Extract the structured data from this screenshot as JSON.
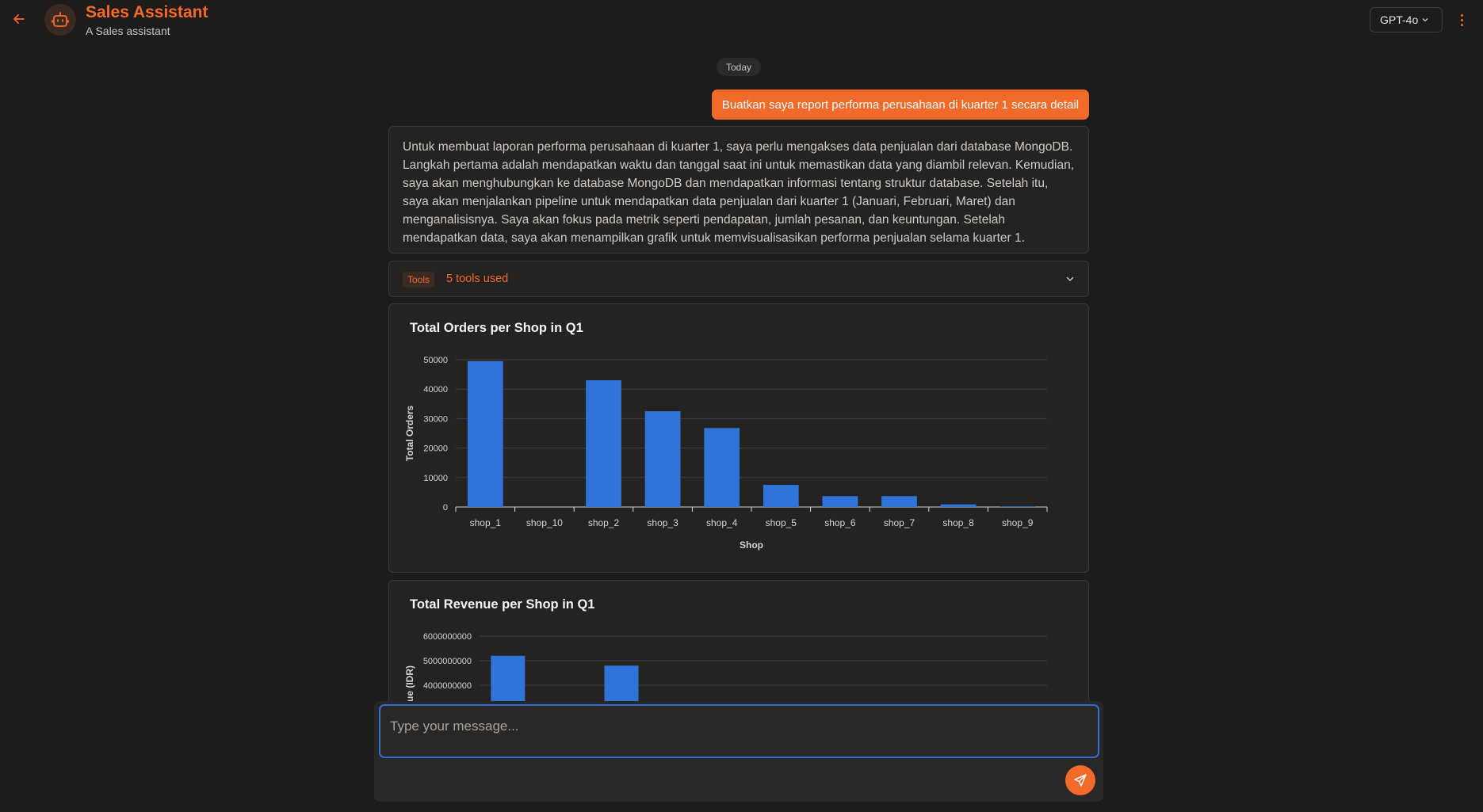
{
  "header": {
    "title": "Sales Assistant",
    "subtitle": "A Sales assistant",
    "model": "GPT-4o"
  },
  "chat": {
    "date_label": "Today",
    "user_message": "Buatkan saya report performa perusahaan di kuarter 1 secara detail",
    "assistant_message": "Untuk membuat laporan performa perusahaan di kuarter 1, saya perlu mengakses data penjualan dari database MongoDB. Langkah pertama adalah mendapatkan waktu dan tanggal saat ini untuk memastikan data yang diambil relevan. Kemudian, saya akan menghubungkan ke database MongoDB dan mendapatkan informasi tentang struktur database. Setelah itu, saya akan menjalankan pipeline untuk mendapatkan data penjualan dari kuarter 1 (Januari, Februari, Maret) dan menganalisisnya. Saya akan fokus pada metrik seperti pendapatan, jumlah pesanan, dan keuntungan. Setelah mendapatkan data, saya akan menampilkan grafik untuk memvisualisasikan performa penjualan selama kuarter 1.",
    "tools_badge": "Tools",
    "tools_count": "5 tools used"
  },
  "composer": {
    "placeholder": "Type your message..."
  },
  "colors": {
    "accent": "#f26a2a",
    "bar": "#2f74d8",
    "background": "#1e1c1b"
  },
  "chart_data": [
    {
      "type": "bar",
      "title": "Total Orders per Shop in Q1",
      "xlabel": "Shop",
      "ylabel": "Total Orders",
      "categories": [
        "shop_1",
        "shop_10",
        "shop_2",
        "shop_3",
        "shop_4",
        "shop_5",
        "shop_6",
        "shop_7",
        "shop_8",
        "shop_9"
      ],
      "values": [
        49500,
        0,
        43000,
        32500,
        26800,
        7500,
        3700,
        3700,
        900,
        200
      ],
      "yticks": [
        "0",
        "10000",
        "20000",
        "30000",
        "40000",
        "50000"
      ],
      "ylim": [
        0,
        50000
      ],
      "grid": true
    },
    {
      "type": "bar",
      "title": "Total Revenue per Shop in Q1",
      "ylabel": "ue (IDR)",
      "visible_yticks": [
        "6000000000",
        "5000000000",
        "4000000000"
      ],
      "visible_values": [
        {
          "category_index": 0,
          "value": 5200000000
        },
        {
          "category_index": 2,
          "value": 4800000000
        }
      ],
      "grid": true
    }
  ]
}
